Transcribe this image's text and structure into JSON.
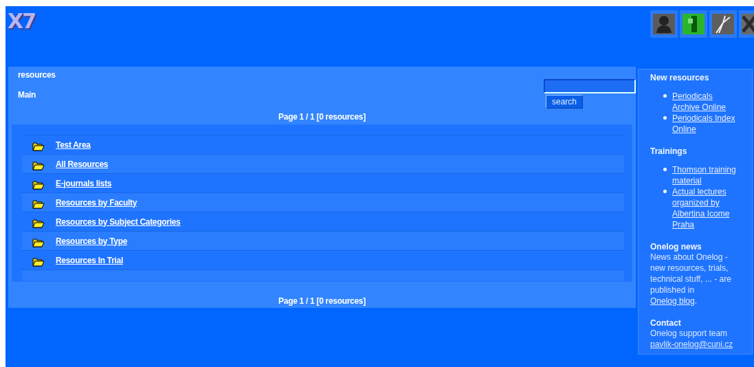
{
  "logo": "X7",
  "toolbar": [
    {
      "kind": "user"
    },
    {
      "kind": "green"
    },
    {
      "kind": "tool"
    },
    {
      "kind": "close"
    }
  ],
  "breadcrumb": "resources",
  "heading": "Main",
  "search": {
    "button": "search"
  },
  "pager_top": "Page 1 / 1 [0 resources]",
  "folders": [
    {
      "label": "Test Area"
    },
    {
      "label": "All Resources"
    },
    {
      "label": "E-journals lists"
    },
    {
      "label": "Resources by Faculty"
    },
    {
      "label": "Resources by Subject Categories"
    },
    {
      "label": "Resources by Type"
    },
    {
      "label": "Resources In Trial"
    }
  ],
  "pager_bottom": "Page 1 / 1 [0 resources]",
  "sidebar": [
    {
      "kind": "links",
      "title": "New resources",
      "items": [
        "Periodicals Archive Online",
        "Periodicals Index Online"
      ]
    },
    {
      "kind": "links",
      "title": "Trainings",
      "items": [
        "Thomson training material",
        "Actual lectures organized by Albertina Icome Praha"
      ]
    },
    {
      "kind": "text",
      "title": "Onelog news",
      "before": "News about Onelog - new resources, trials, technical stuff, ... - are published in ",
      "link": "Onelog blog",
      "after": "."
    },
    {
      "kind": "contact",
      "title": "Contact",
      "before": "Onelog support team",
      "link": "pavlik-onelog@cuni.cz"
    }
  ]
}
